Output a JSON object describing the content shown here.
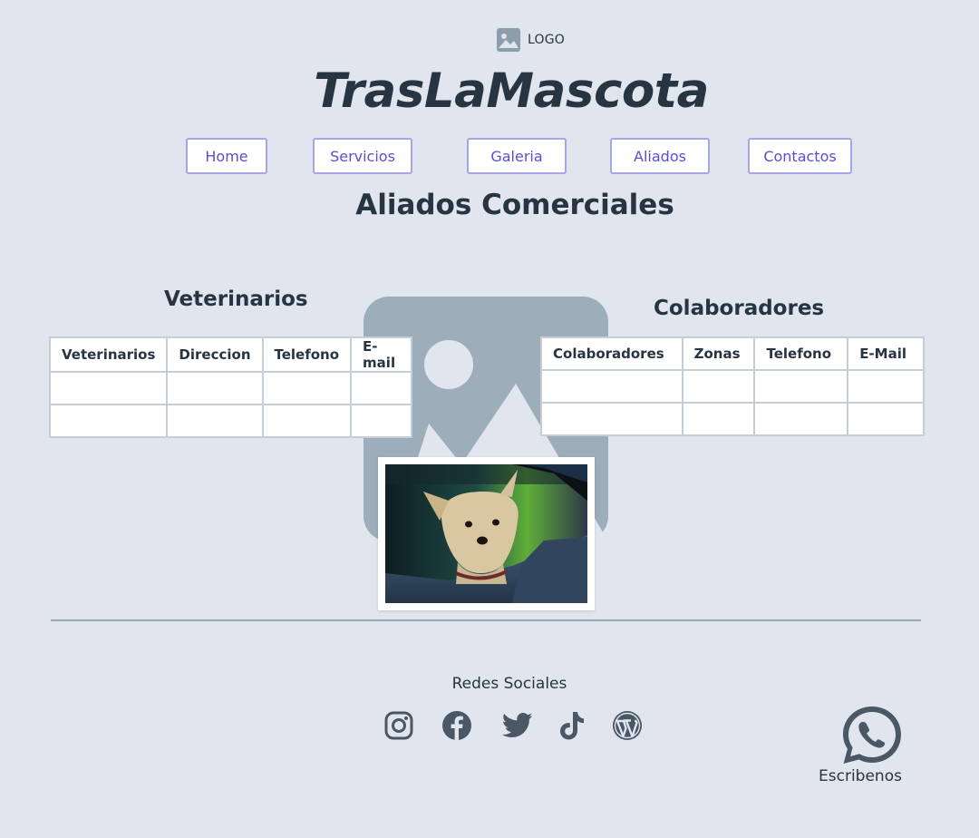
{
  "header": {
    "logo_text": "LOGO",
    "logo_icon": "image-placeholder-icon",
    "brand": "TrasLaMascota"
  },
  "nav": {
    "items": [
      {
        "label": "Home"
      },
      {
        "label": "Servicios"
      },
      {
        "label": "Galeria"
      },
      {
        "label": "Aliados"
      },
      {
        "label": "Contactos"
      }
    ]
  },
  "main": {
    "title": "Aliados Comerciales",
    "veterinarios": {
      "title": "Veterinarios",
      "columns": [
        "Veterinarios",
        "Direccion",
        "Telefono",
        "E-mail"
      ],
      "rows": [
        [
          "",
          "",
          "",
          ""
        ],
        [
          "",
          "",
          "",
          ""
        ]
      ]
    },
    "colaboradores": {
      "title": "Colaboradores",
      "columns": [
        "Colaboradores",
        "Zonas",
        "Telefono",
        "E-Mail"
      ],
      "rows": [
        [
          "",
          "",
          "",
          ""
        ],
        [
          "",
          "",
          "",
          ""
        ]
      ]
    },
    "photo_icon": "dog-in-car-photo"
  },
  "footer": {
    "social_label": "Redes Sociales",
    "social_icons": [
      "instagram-icon",
      "facebook-icon",
      "twitter-icon",
      "tiktok-icon",
      "wordpress-icon"
    ],
    "whatsapp_label": "Escribenos"
  },
  "colors": {
    "background": "#e0e5ee",
    "text": "#273442",
    "nav_text": "#5a4fcf",
    "nav_border": "#a8a4ec",
    "icon": "#4a5765",
    "placeholder": "#9eadba"
  }
}
